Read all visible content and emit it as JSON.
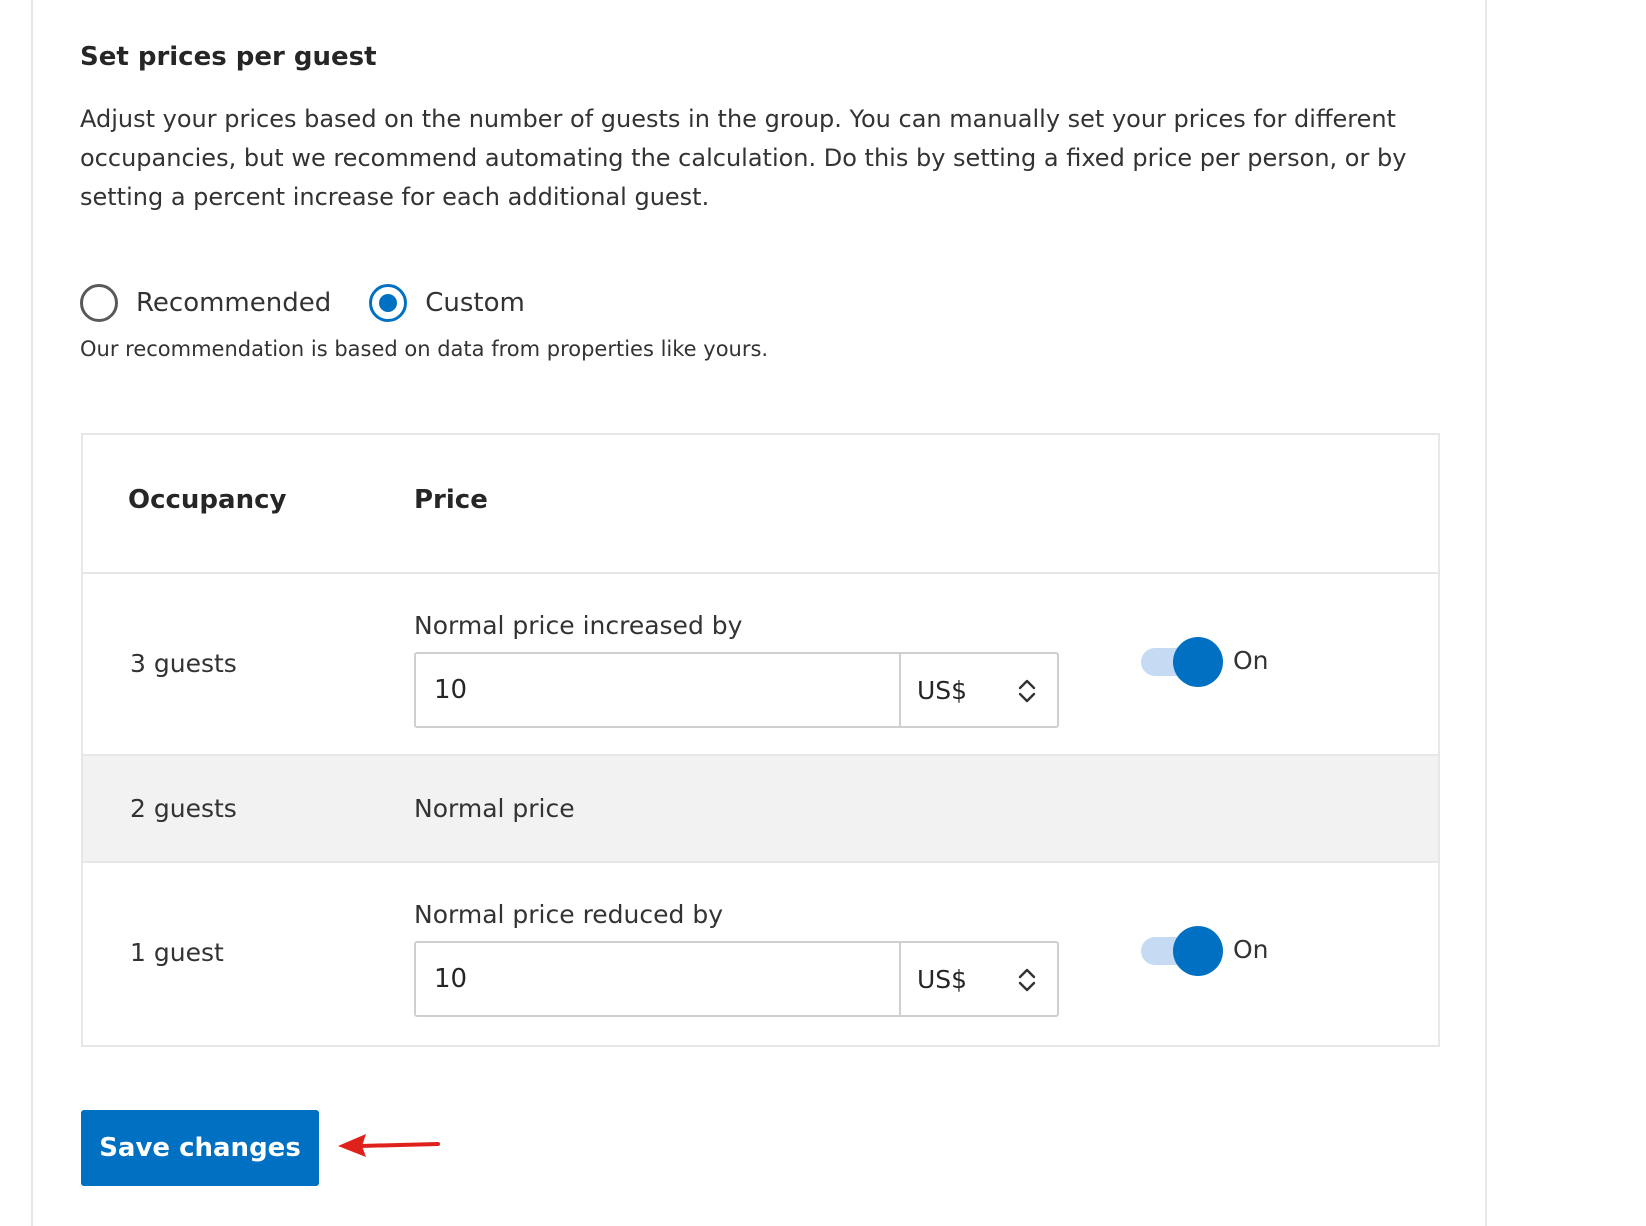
{
  "section": {
    "title": "Set prices per guest",
    "description": "Adjust your prices based on the number of guests in the group. You can manually set your prices for different occupancies, but we recommend automating the calculation. Do this by setting a fixed price per person, or by setting a percent increase for each additional guest."
  },
  "pricing_mode": {
    "options": [
      {
        "label": "Recommended",
        "selected": false
      },
      {
        "label": "Custom",
        "selected": true
      }
    ],
    "hint": "Our recommendation is based on data from properties like yours."
  },
  "table": {
    "headers": {
      "occupancy": "Occupancy",
      "price": "Price"
    },
    "rows": [
      {
        "occupancy": "3 guests",
        "field_label": "Normal price increased by",
        "value": "10",
        "currency": "US$",
        "toggle_on": true,
        "toggle_label": "On"
      },
      {
        "occupancy": "2 guests",
        "price_text": "Normal price"
      },
      {
        "occupancy": "1 guest",
        "field_label": "Normal price reduced by",
        "value": "10",
        "currency": "US$",
        "toggle_on": true,
        "toggle_label": "On"
      }
    ]
  },
  "actions": {
    "save_label": "Save changes"
  },
  "colors": {
    "accent": "#0071c2",
    "toggle_track": "#c5dbf3",
    "base_row_bg": "#f2f2f2",
    "annotation_arrow": "#e0201b"
  },
  "icons": {
    "currency_select": "chevron-up-down-icon",
    "annotation": "red-arrow-icon"
  }
}
